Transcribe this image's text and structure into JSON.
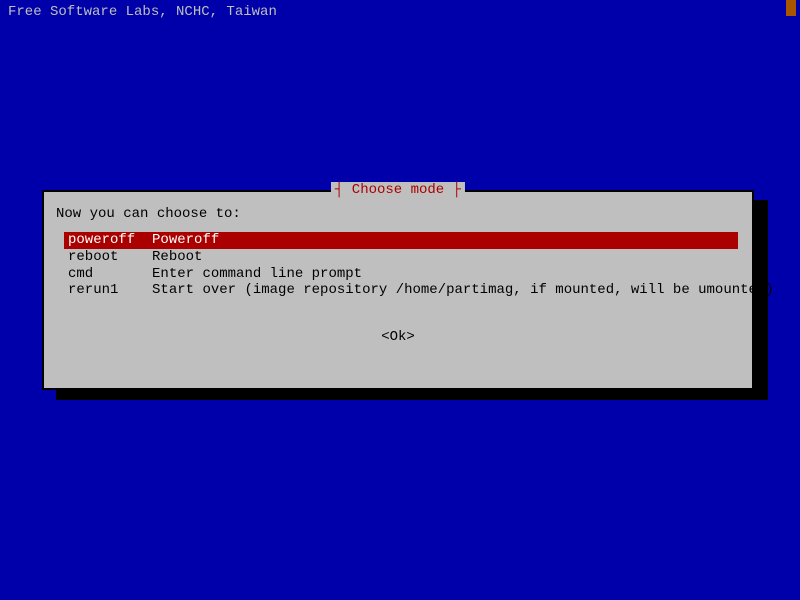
{
  "header": {
    "text": "Free Software Labs, NCHC, Taiwan"
  },
  "dialog": {
    "title": "Choose mode",
    "prompt": "Now you can choose to:",
    "menu": [
      {
        "key": "poweroff",
        "label": "Poweroff",
        "selected": true
      },
      {
        "key": "reboot",
        "label": "Reboot",
        "selected": false
      },
      {
        "key": "cmd",
        "label": "Enter command line prompt",
        "selected": false
      },
      {
        "key": "rerun1",
        "label": "Start over (image repository /home/partimag, if mounted, will be umounted)",
        "selected": false
      }
    ],
    "ok_label": "<Ok>"
  },
  "colors": {
    "background": "#0000aa",
    "dialog_bg": "#bfbfbf",
    "title": "#aa0000",
    "selected_bg": "#aa0000",
    "selected_fg": "#ffffff",
    "text": "#000000",
    "cursor": "#aa5500"
  }
}
